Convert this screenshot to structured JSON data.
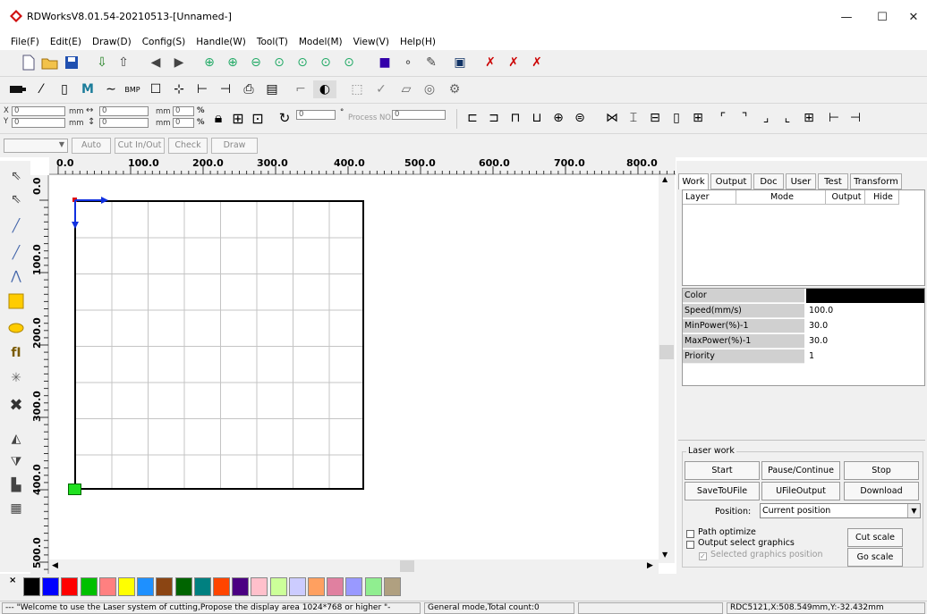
{
  "window": {
    "title": "RDWorksV8.01.54-20210513-[Unnamed-]",
    "minimize": "—",
    "maximize": "☐",
    "close": "✕"
  },
  "menu": [
    "File(F)",
    "Edit(E)",
    "Draw(D)",
    "Config(S)",
    "Handle(W)",
    "Tool(T)",
    "Model(M)",
    "View(V)",
    "Help(H)"
  ],
  "coords": {
    "x_label": "X",
    "y_label": "Y",
    "x_value": "0",
    "y_value": "0",
    "unit_mm": "mm",
    "w_value": "0",
    "h_value": "0",
    "pw_value": "0",
    "ph_value": "0",
    "percent": "%",
    "rotate_value": "0",
    "degree": "°",
    "process_label": "Process NO:",
    "process_value": "0"
  },
  "toolbar3": {
    "auto": "Auto",
    "cut_in_out": "Cut In/Out",
    "check": "Check",
    "draw": "Draw"
  },
  "ruler": {
    "h": [
      "0.0",
      "100.0",
      "200.0",
      "300.0",
      "400.0",
      "500.0",
      "600.0",
      "700.0",
      "800.0"
    ],
    "v": [
      "0.0",
      "100.0",
      "200.0",
      "300.0",
      "400.0",
      "500.0"
    ]
  },
  "tabs": [
    "Work",
    "Output",
    "Doc",
    "User",
    "Test",
    "Transform"
  ],
  "layer_table": {
    "headers": [
      "Layer",
      "Mode",
      "Output",
      "Hide"
    ]
  },
  "props": [
    {
      "key": "Color",
      "value": ""
    },
    {
      "key": "Speed(mm/s)",
      "value": "100.0"
    },
    {
      "key": "MinPower(%)-1",
      "value": "30.0"
    },
    {
      "key": "MaxPower(%)-1",
      "value": "30.0"
    },
    {
      "key": "Priority",
      "value": "1"
    }
  ],
  "laser_work": {
    "title": "Laser work",
    "start": "Start",
    "pause": "Pause/Continue",
    "stop": "Stop",
    "save_u": "SaveToUFile",
    "ufile_output": "UFileOutput",
    "download": "Download",
    "position_label": "Position:",
    "position_value": "Current position",
    "path_optimize": "Path optimize",
    "output_select": "Output select graphics",
    "selected_pos": "Selected graphics position",
    "cut_scale": "Cut scale",
    "go_scale": "Go scale"
  },
  "palette": {
    "colors": [
      "#000000",
      "#0000ff",
      "#ff0000",
      "#00c000",
      "#ff8080",
      "#ffff00",
      "#1e90ff",
      "#8b4513",
      "#006400",
      "#008080",
      "#ff4500",
      "#4b0082",
      "#ffc0cb",
      "#ccff99",
      "#ccccff",
      "#ffa060",
      "#e080a0",
      "#9999ff",
      "#90ee90",
      "#b0a080"
    ]
  },
  "status": {
    "welcome": "--- \"Welcome to use the Laser system of cutting,Propose the display area 1024*768 or higher \"-",
    "mode": "General mode,Total count:0",
    "blank": "",
    "device": "RDC5121,X:508.549mm,Y:-32.432mm"
  }
}
